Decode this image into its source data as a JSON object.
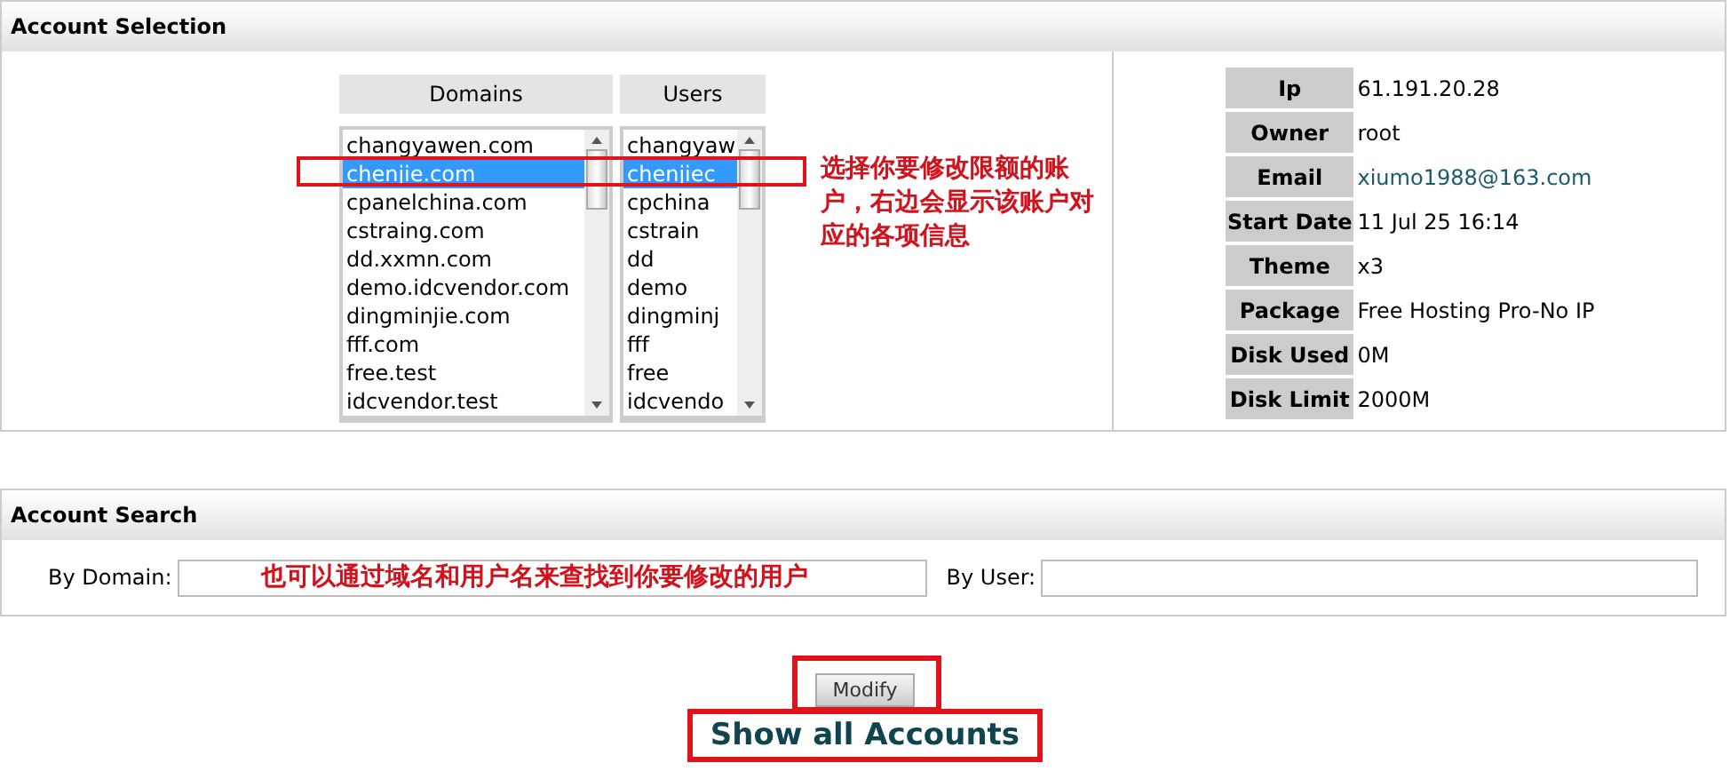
{
  "account_selection": {
    "title": "Account Selection",
    "domains": {
      "heading": "Domains",
      "items": [
        {
          "label": "changyawen.com",
          "selected": false
        },
        {
          "label": "chenjie.com",
          "selected": true
        },
        {
          "label": "cpanelchina.com",
          "selected": false
        },
        {
          "label": "cstraing.com",
          "selected": false
        },
        {
          "label": "dd.xxmn.com",
          "selected": false
        },
        {
          "label": "demo.idcvendor.com",
          "selected": false
        },
        {
          "label": "dingminjie.com",
          "selected": false
        },
        {
          "label": "fff.com",
          "selected": false
        },
        {
          "label": "free.test",
          "selected": false
        },
        {
          "label": "idcvendor.test",
          "selected": false
        }
      ]
    },
    "users": {
      "heading": "Users",
      "items": [
        {
          "label": "changyaw",
          "selected": false
        },
        {
          "label": "chenjiec",
          "selected": true
        },
        {
          "label": "cpchina",
          "selected": false
        },
        {
          "label": "cstrain",
          "selected": false
        },
        {
          "label": "dd",
          "selected": false
        },
        {
          "label": "demo",
          "selected": false
        },
        {
          "label": "dingminj",
          "selected": false
        },
        {
          "label": "fff",
          "selected": false
        },
        {
          "label": "free",
          "selected": false
        },
        {
          "label": "idcvendo",
          "selected": false
        }
      ]
    },
    "annotation": "选择你要修改限额的账户，右边会显示该账户对应的各项信息",
    "info": [
      {
        "label": "Ip",
        "value": "61.191.20.28",
        "kind": "text"
      },
      {
        "label": "Owner",
        "value": "root",
        "kind": "text"
      },
      {
        "label": "Email",
        "value": "xiumo1988@163.com",
        "kind": "link"
      },
      {
        "label": "Start Date",
        "value": "11 Jul 25 16:14",
        "kind": "text"
      },
      {
        "label": "Theme",
        "value": "x3",
        "kind": "text"
      },
      {
        "label": "Package",
        "value": "Free Hosting Pro-No IP",
        "kind": "text"
      },
      {
        "label": "Disk Used",
        "value": "0M",
        "kind": "text"
      },
      {
        "label": "Disk Limit",
        "value": "2000M",
        "kind": "text"
      }
    ]
  },
  "account_search": {
    "title": "Account Search",
    "domain_label": "By Domain:",
    "user_label": "By User:",
    "annotation": "也可以通过域名和用户名来查找到你要修改的用户"
  },
  "modify_button": "Modify",
  "show_all_link": "Show all Accounts"
}
